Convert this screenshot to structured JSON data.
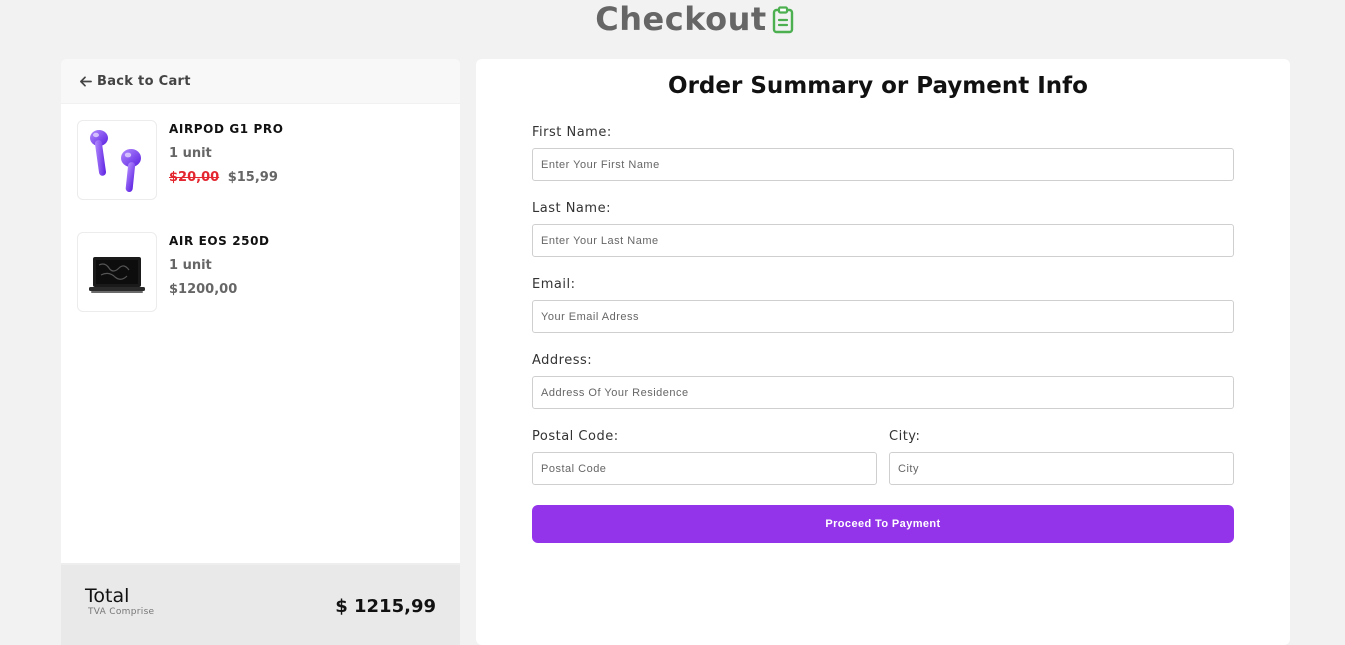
{
  "header": {
    "title": "Checkout",
    "icon": "clipboard-icon",
    "icon_color": "#4caf50"
  },
  "cart": {
    "back_label": "Back to Cart",
    "items": [
      {
        "name": "AIRPOD G1 PRO",
        "units": "1 unit",
        "old_price": "$20,00",
        "price": "$15,99",
        "image_icon": "airpods-image"
      },
      {
        "name": "AIR EOS 250D",
        "units": "1 unit",
        "price": "$1200,00",
        "image_icon": "laptop-image"
      }
    ],
    "total_label": "Total",
    "total_sub": "TVA Comprise",
    "total_value": "$ 1215,99"
  },
  "form": {
    "title": "Order Summary or Payment Info",
    "first_name": {
      "label": "First Name:",
      "placeholder": "Enter Your First Name",
      "value": ""
    },
    "last_name": {
      "label": "Last Name:",
      "placeholder": "Enter Your Last Name",
      "value": ""
    },
    "email": {
      "label": "Email:",
      "placeholder": "Your Email Adress",
      "value": ""
    },
    "address": {
      "label": "Address:",
      "placeholder": "Address Of Your Residence",
      "value": ""
    },
    "postal_code": {
      "label": "Postal Code:",
      "placeholder": "Postal Code",
      "value": ""
    },
    "city": {
      "label": "City:",
      "placeholder": "City",
      "value": ""
    },
    "submit_label": "Proceed To Payment"
  },
  "colors": {
    "accent": "#9333ea",
    "old_price": "#e3262f",
    "background": "#f2f2f2"
  }
}
